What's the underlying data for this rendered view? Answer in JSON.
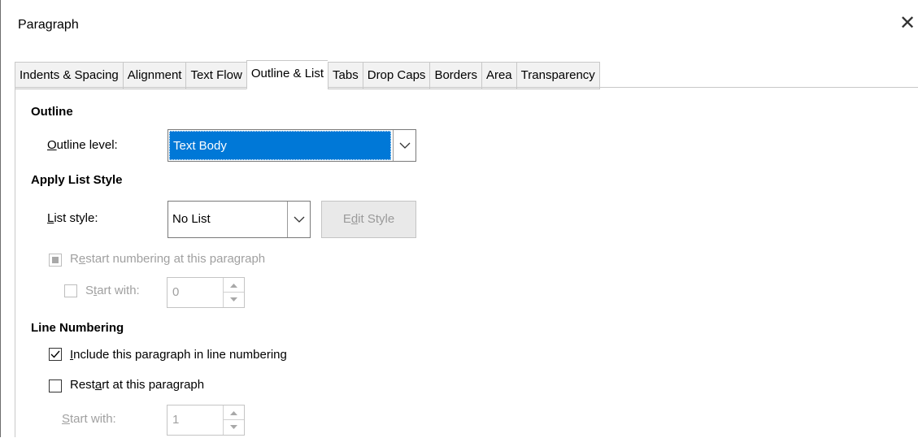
{
  "window": {
    "title": "Paragraph",
    "close_glyph": "✕"
  },
  "tabs": [
    {
      "label": "Indents & Spacing"
    },
    {
      "label": "Alignment"
    },
    {
      "label": "Text Flow"
    },
    {
      "label": "Outline & List",
      "active": true
    },
    {
      "label": "Tabs"
    },
    {
      "label": "Drop Caps"
    },
    {
      "label": "Borders"
    },
    {
      "label": "Area"
    },
    {
      "label": "Transparency"
    }
  ],
  "outline": {
    "heading": "Outline",
    "level_label_u": "O",
    "level_label_rest": "utline level:",
    "level_value": "Text Body"
  },
  "list_style": {
    "heading": "Apply List Style",
    "style_label_u": "L",
    "style_label_rest": "ist style:",
    "style_value": "No List",
    "edit_btn_pre": "E",
    "edit_btn_u": "d",
    "edit_btn_rest": "it Style",
    "restart_pre": "R",
    "restart_u": "e",
    "restart_rest": "start numbering at this paragraph",
    "start_pre": "S",
    "start_u": "t",
    "start_rest": "art with:",
    "start_value": "0"
  },
  "line_numbering": {
    "heading": "Line Numbering",
    "include_u": "I",
    "include_rest": "nclude this paragraph in line numbering",
    "include_checked": true,
    "restart_pre": "Rest",
    "restart_u": "a",
    "restart_rest": "rt at this paragraph",
    "restart_checked": false,
    "start_u": "S",
    "start_rest": "tart with:",
    "start_value": "1"
  }
}
